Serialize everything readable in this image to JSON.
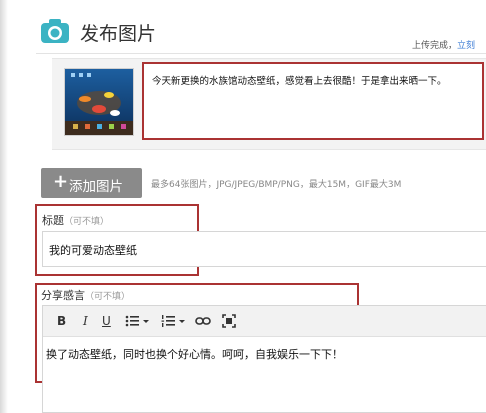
{
  "header": {
    "title": "发布图片",
    "upload_status_text": "上传完成，",
    "upload_status_link": "立刻"
  },
  "photo": {
    "caption": "今天新更换的水族馆动态壁纸，感觉看上去很酷！于是拿出来晒一下。"
  },
  "add_photo_button": {
    "plus": "+",
    "label": "添加图片"
  },
  "upload_hint": "最多64张图片，JPG/JPEG/BMP/PNG，最大15M，GIF最大3M",
  "title_field": {
    "label": "标题",
    "optional_note": "（可不填）",
    "value": "我的可爱动态壁纸"
  },
  "share_field": {
    "label": "分享感言",
    "optional_note": "（可不填）",
    "content": "换了动态壁纸，同时也换个好心情。呵呵，自我娱乐一下下！"
  },
  "toolbar": {
    "bold": "B",
    "italic": "I",
    "underline": "U"
  },
  "colors": {
    "accent": "#3bb3c3",
    "highlight_border": "#aa3333",
    "button_gray": "#8a8a8a"
  }
}
